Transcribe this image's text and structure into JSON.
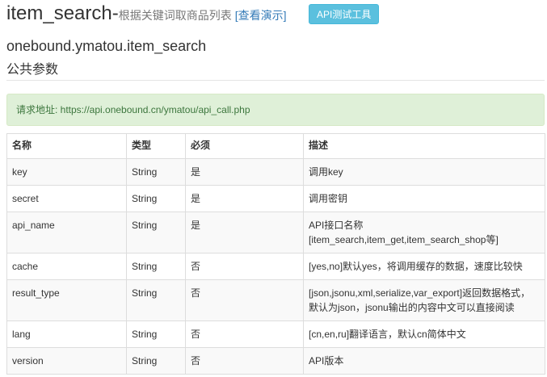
{
  "header": {
    "title": "item_search-",
    "subtitle": "根据关键词取商品列表",
    "demo_link": "[查看演示]",
    "api_button": "API测试工具"
  },
  "api_name": "onebound.ymatou.item_search",
  "section_title": "公共参数",
  "alert": {
    "text": "请求地址: https://api.onebound.cn/ymatou/api_call.php"
  },
  "table": {
    "headers": [
      "名称",
      "类型",
      "必须",
      "描述"
    ],
    "rows": [
      {
        "name": "key",
        "type": "String",
        "required": "是",
        "desc": "调用key"
      },
      {
        "name": "secret",
        "type": "String",
        "required": "是",
        "desc": "调用密钥"
      },
      {
        "name": "api_name",
        "type": "String",
        "required": "是",
        "desc": "API接口名称[item_search,item_get,item_search_shop等]"
      },
      {
        "name": "cache",
        "type": "String",
        "required": "否",
        "desc": "[yes,no]默认yes，将调用缓存的数据，速度比较快"
      },
      {
        "name": "result_type",
        "type": "String",
        "required": "否",
        "desc": "[json,jsonu,xml,serialize,var_export]返回数据格式，默认为json，jsonu输出的内容中文可以直接阅读"
      },
      {
        "name": "lang",
        "type": "String",
        "required": "否",
        "desc": "[cn,en,ru]翻译语言，默认cn简体中文"
      },
      {
        "name": "version",
        "type": "String",
        "required": "否",
        "desc": "API版本"
      }
    ]
  }
}
